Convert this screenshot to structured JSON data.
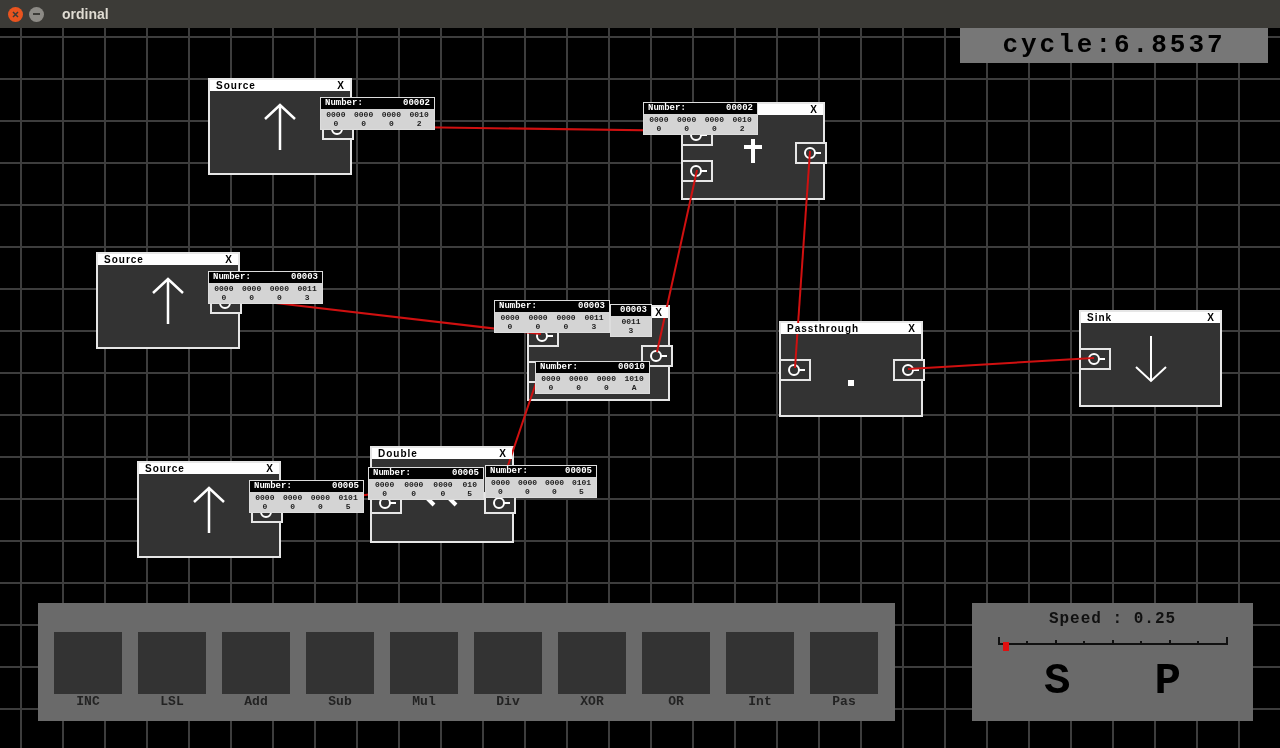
{
  "window": {
    "title": "ordinal"
  },
  "cycle": "cycle:6.8537",
  "nodes": [
    {
      "kind": "source",
      "title": "Source",
      "close": "X"
    },
    {
      "kind": "cross",
      "close": "X"
    },
    {
      "kind": "source",
      "title": "Source",
      "close": "X"
    },
    {
      "kind": "blank",
      "close": "X"
    },
    {
      "kind": "passthrough",
      "title": "Passthrough",
      "close": "X"
    },
    {
      "kind": "sink",
      "title": "Sink",
      "close": "X"
    },
    {
      "kind": "double",
      "title": "Double",
      "close": "X"
    },
    {
      "kind": "source",
      "title": "Source",
      "close": "X"
    }
  ],
  "tooltips": [
    {
      "label": "Number:",
      "value": "00002",
      "bits": [
        "0000",
        "0000",
        "0000",
        "0010"
      ],
      "digits": [
        "0",
        "0",
        "0",
        "2"
      ]
    },
    {
      "label": "Number:",
      "value": "00002",
      "bits": [
        "0000",
        "0000",
        "0000",
        "0010"
      ],
      "digits": [
        "0",
        "0",
        "0",
        "2"
      ]
    },
    {
      "label": "Number:",
      "value": "00003",
      "bits": [
        "0000",
        "0000",
        "0000",
        "0011"
      ],
      "digits": [
        "0",
        "0",
        "0",
        "3"
      ]
    },
    {
      "value": "00003",
      "bits": [
        "0011"
      ],
      "digits": [
        "3"
      ]
    },
    {
      "label": "Number:",
      "value": "00003",
      "bits": [
        "0000",
        "0000",
        "0000",
        "0011"
      ],
      "digits": [
        "0",
        "0",
        "0",
        "3"
      ]
    },
    {
      "label": "Number:",
      "value": "00010",
      "bits": [
        "0000",
        "0000",
        "0000",
        "1010"
      ],
      "digits": [
        "0",
        "0",
        "0",
        "A"
      ]
    },
    {
      "label": "Number:",
      "value": "00005",
      "bits": [
        "0000",
        "0000",
        "0000",
        "0101"
      ],
      "digits": [
        "0",
        "0",
        "0",
        "5"
      ]
    },
    {
      "label": "Number:",
      "value": "00005",
      "bits": [
        "0000",
        "0000",
        "0000",
        "010"
      ],
      "digits": [
        "0",
        "0",
        "0",
        "5"
      ]
    },
    {
      "label": "Number:",
      "value": "00005",
      "bits": [
        "0000",
        "0000",
        "0000",
        "0101"
      ],
      "digits": [
        "0",
        "0",
        "0",
        "5"
      ]
    }
  ],
  "palette": [
    {
      "label": "INC"
    },
    {
      "label": "LSL"
    },
    {
      "label": "Add"
    },
    {
      "label": "Sub"
    },
    {
      "label": "Mul"
    },
    {
      "label": "Div"
    },
    {
      "label": "XOR"
    },
    {
      "label": "OR"
    },
    {
      "label": "Int"
    },
    {
      "label": "Pas"
    }
  ],
  "speed": {
    "label": "Speed : 0.25",
    "level": 0.03,
    "buttons": [
      "S",
      "P"
    ]
  }
}
